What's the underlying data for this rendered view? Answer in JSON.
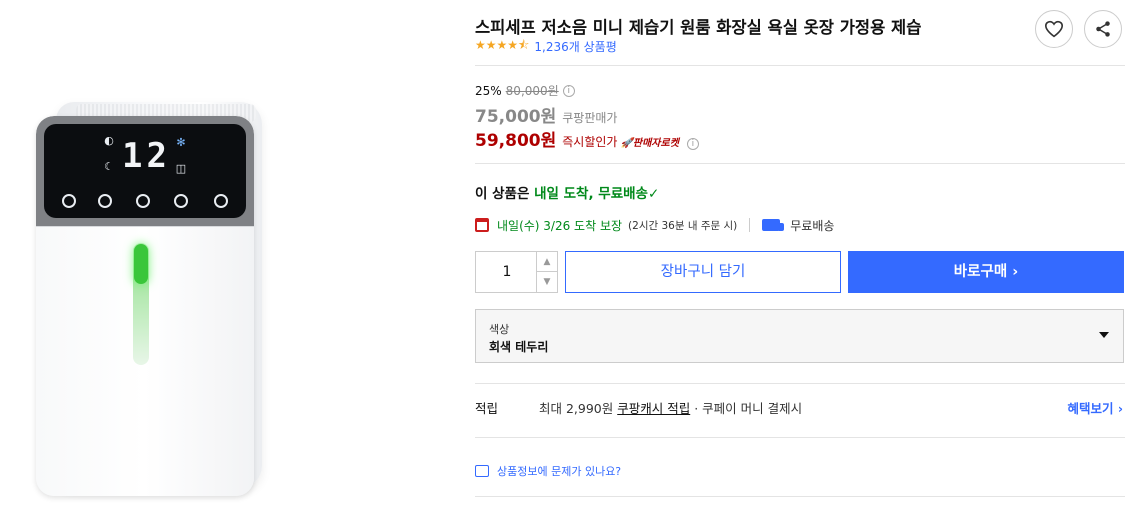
{
  "product": {
    "title": "스피세프 저소음 미니 제습기 원룸 화장실 욕실 옷장 가정용 제습",
    "rating_stars": "★★★★⯪",
    "rating_value": 4.5,
    "review_count": "1,236개 상품평"
  },
  "display": {
    "digits": "12"
  },
  "pricing": {
    "discount_rate": "25%",
    "original_price": "80,000원",
    "coupang_price": "75,000원",
    "coupang_price_label": "쿠팡판매가",
    "instant_price": "59,800원",
    "instant_price_label": "즉시할인가",
    "seller_badge": "판매자로켓"
  },
  "delivery": {
    "prefix": "이 상품은 ",
    "highlight": "내일 도착, 무료배송",
    "check": "✓",
    "date_text": "내일(수) 3/26 도착 보장",
    "order_note": "(2시간 36분 내 주문 시)",
    "free_shipping": "무료배송"
  },
  "purchase": {
    "quantity": "1",
    "cart_label": "장바구니 담기",
    "buy_label": "바로구매 ›"
  },
  "option": {
    "label": "색상",
    "value": "회색 테두리"
  },
  "points": {
    "title": "적립",
    "text_prefix": "최대 2,990원 ",
    "link_text": "쿠팡캐시 적립",
    "text_suffix": " · 쿠페이 머니 결제시",
    "benefit_label": "혜택보기 ›"
  },
  "report": {
    "text": "상품정보에 문제가 있나요?"
  },
  "colors": {
    "accent": "#346aff",
    "sale": "#ae0000",
    "delivery_green": "#00891a",
    "star": "#f5a623"
  }
}
